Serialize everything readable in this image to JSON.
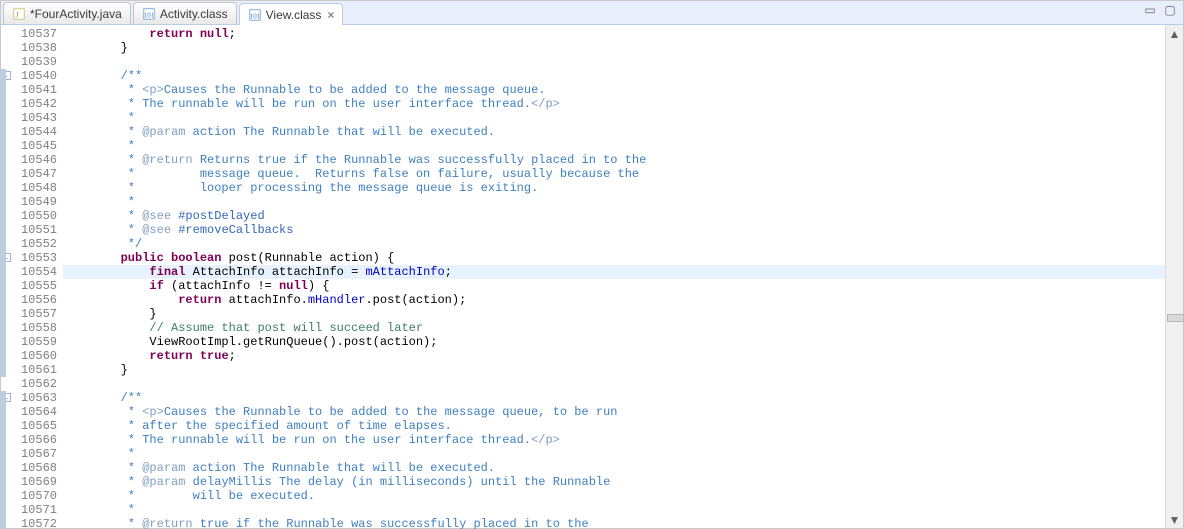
{
  "tabs": [
    {
      "label": "*FourActivity.java",
      "icon": "java-file-icon",
      "active": false
    },
    {
      "label": "Activity.class",
      "icon": "class-file-icon",
      "active": false
    },
    {
      "label": "View.class",
      "icon": "class-file-icon",
      "active": true
    }
  ],
  "windowControls": {
    "minimize": "▭",
    "maximize": "▢"
  },
  "scrollbar": {
    "upArrow": "▲",
    "downArrow": "▼"
  },
  "gutter": {
    "start": 10537,
    "end": 10572
  },
  "highlightedLine": 10554,
  "foldMarkers": [
    {
      "line": 10540,
      "symbol": "-"
    },
    {
      "line": 10553,
      "symbol": "-"
    },
    {
      "line": 10563,
      "symbol": "-"
    }
  ],
  "sideMarkers": [
    {
      "from": 10540,
      "to": 10561
    },
    {
      "from": 10563,
      "to": 10572
    }
  ],
  "code": {
    "10537": [
      [
        "            ",
        ""
      ],
      [
        "return",
        "kw"
      ],
      [
        " ",
        ""
      ],
      [
        "null",
        "kw"
      ],
      [
        ";",
        ""
      ]
    ],
    "10538": [
      [
        "        }",
        ""
      ]
    ],
    "10539": [
      [
        "",
        ""
      ]
    ],
    "10540": [
      [
        "        ",
        ""
      ],
      [
        "/**",
        "cm"
      ]
    ],
    "10541": [
      [
        "         * ",
        "cm"
      ],
      [
        "<p>",
        "tag"
      ],
      [
        "Causes the Runnable to be added to the message queue.",
        "cm"
      ]
    ],
    "10542": [
      [
        "         * The runnable will be run on the user interface thread.",
        "cm"
      ],
      [
        "</p>",
        "tag"
      ]
    ],
    "10543": [
      [
        "         *",
        "cm"
      ]
    ],
    "10544": [
      [
        "         * ",
        "cm"
      ],
      [
        "@param",
        "tag"
      ],
      [
        " action The Runnable that will be executed.",
        "cm"
      ]
    ],
    "10545": [
      [
        "         *",
        "cm"
      ]
    ],
    "10546": [
      [
        "         * ",
        "cm"
      ],
      [
        "@return",
        "tag"
      ],
      [
        " Returns true if the Runnable was successfully placed in to the",
        "cm"
      ]
    ],
    "10547": [
      [
        "         *         message queue.  Returns false on failure, usually because the",
        "cm"
      ]
    ],
    "10548": [
      [
        "         *         looper processing the message queue is exiting.",
        "cm"
      ]
    ],
    "10549": [
      [
        "         *",
        "cm"
      ]
    ],
    "10550": [
      [
        "         * ",
        "cm"
      ],
      [
        "@see",
        "tag"
      ],
      [
        " ",
        "cm"
      ],
      [
        "#postDelayed",
        "doclink"
      ]
    ],
    "10551": [
      [
        "         * ",
        "cm"
      ],
      [
        "@see",
        "tag"
      ],
      [
        " ",
        "cm"
      ],
      [
        "#removeCallbacks",
        "doclink"
      ]
    ],
    "10552": [
      [
        "         */",
        "cm"
      ]
    ],
    "10553": [
      [
        "        ",
        ""
      ],
      [
        "public",
        "kw"
      ],
      [
        " ",
        ""
      ],
      [
        "boolean",
        "kw"
      ],
      [
        " post(Runnable action) {",
        ""
      ]
    ],
    "10554": [
      [
        "            ",
        ""
      ],
      [
        "final",
        "kw"
      ],
      [
        " AttachInfo attachInfo = ",
        ""
      ],
      [
        "mAttachInfo",
        "fld"
      ],
      [
        ";",
        ""
      ]
    ],
    "10555": [
      [
        "            ",
        ""
      ],
      [
        "if",
        "kw"
      ],
      [
        " (attachInfo != ",
        ""
      ],
      [
        "null",
        "kw"
      ],
      [
        ") {",
        ""
      ]
    ],
    "10556": [
      [
        "                ",
        ""
      ],
      [
        "return",
        "kw"
      ],
      [
        " attachInfo.",
        ""
      ],
      [
        "mHandler",
        "fld"
      ],
      [
        ".post(action);",
        ""
      ]
    ],
    "10557": [
      [
        "            }",
        ""
      ]
    ],
    "10558": [
      [
        "            ",
        ""
      ],
      [
        "// Assume that post will succeed later",
        "singlecm"
      ]
    ],
    "10559": [
      [
        "            ViewRootImpl.getRunQueue().post(action);",
        ""
      ]
    ],
    "10560": [
      [
        "            ",
        ""
      ],
      [
        "return",
        "kw"
      ],
      [
        " ",
        ""
      ],
      [
        "true",
        "kw"
      ],
      [
        ";",
        ""
      ]
    ],
    "10561": [
      [
        "        }",
        ""
      ]
    ],
    "10562": [
      [
        "",
        ""
      ]
    ],
    "10563": [
      [
        "        ",
        ""
      ],
      [
        "/**",
        "cm"
      ]
    ],
    "10564": [
      [
        "         * ",
        "cm"
      ],
      [
        "<p>",
        "tag"
      ],
      [
        "Causes the Runnable to be added to the message queue, to be run",
        "cm"
      ]
    ],
    "10565": [
      [
        "         * after the specified amount of time elapses.",
        "cm"
      ]
    ],
    "10566": [
      [
        "         * The runnable will be run on the user interface thread.",
        "cm"
      ],
      [
        "</p>",
        "tag"
      ]
    ],
    "10567": [
      [
        "         *",
        "cm"
      ]
    ],
    "10568": [
      [
        "         * ",
        "cm"
      ],
      [
        "@param",
        "tag"
      ],
      [
        " action The Runnable that will be executed.",
        "cm"
      ]
    ],
    "10569": [
      [
        "         * ",
        "cm"
      ],
      [
        "@param",
        "tag"
      ],
      [
        " delayMillis The delay (in milliseconds) until the Runnable",
        "cm"
      ]
    ],
    "10570": [
      [
        "         *        will be executed.",
        "cm"
      ]
    ],
    "10571": [
      [
        "         *",
        "cm"
      ]
    ],
    "10572": [
      [
        "         * ",
        "cm"
      ],
      [
        "@return",
        "tag"
      ],
      [
        " true if the Runnable was successfully placed in to the",
        "cm"
      ]
    ]
  }
}
